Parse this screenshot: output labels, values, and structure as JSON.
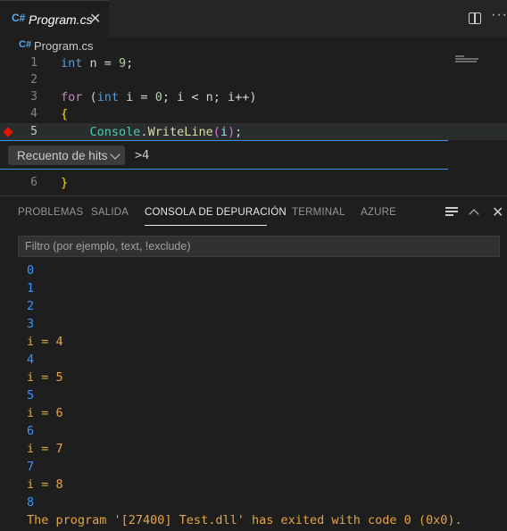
{
  "tab": {
    "icon": "C#",
    "label": "Program.cs",
    "close": "✕"
  },
  "actions": {
    "split": "split-editor-icon",
    "more": "···"
  },
  "breadcrumb": {
    "icon": "C#",
    "label": "Program.cs"
  },
  "editor": {
    "lines": [
      {
        "n": "1",
        "tokens": [
          [
            "int",
            "kw"
          ],
          [
            " n = ",
            "plain"
          ],
          [
            "9",
            "num"
          ],
          [
            ";",
            "plain"
          ]
        ]
      },
      {
        "n": "2",
        "tokens": []
      },
      {
        "n": "3",
        "tokens": [
          [
            "for",
            "kw2"
          ],
          [
            " (",
            "plain"
          ],
          [
            "int",
            "kw"
          ],
          [
            " i = ",
            "plain"
          ],
          [
            "0",
            "num"
          ],
          [
            "; i < n; i++)",
            "plain"
          ]
        ]
      },
      {
        "n": "4",
        "tokens": [
          [
            "{",
            "brace"
          ]
        ]
      },
      {
        "n": "5",
        "tokens": [
          [
            "    ",
            "plain"
          ],
          [
            "Console",
            "cls"
          ],
          [
            ".",
            "plain"
          ],
          [
            "WriteLine",
            "fn"
          ],
          [
            "(",
            "paren"
          ],
          [
            "i",
            "var"
          ],
          [
            ")",
            "paren"
          ],
          [
            ";",
            "plain"
          ]
        ]
      },
      {
        "n": "6",
        "tokens": [
          [
            "}",
            "brace"
          ]
        ]
      }
    ]
  },
  "breakpoint_widget": {
    "condition_type": "Recuento de hits",
    "value": ">4"
  },
  "panel": {
    "tabs": [
      "PROBLEMAS",
      "SALIDA",
      "CONSOLA DE DEPURACIÓN",
      "TERMINAL",
      "AZURE"
    ],
    "active_tab": "CONSOLA DE DEPURACIÓN",
    "filter_placeholder": "Filtro (por ejemplo, text, !exclude)",
    "output": [
      {
        "text": "0",
        "color": "blue"
      },
      {
        "text": "1",
        "color": "blue"
      },
      {
        "text": "2",
        "color": "blue"
      },
      {
        "text": "3",
        "color": "blue"
      },
      {
        "text": "i = 4",
        "color": "orange"
      },
      {
        "text": "4",
        "color": "blue"
      },
      {
        "text": "i = 5",
        "color": "orange"
      },
      {
        "text": "5",
        "color": "blue"
      },
      {
        "text": "i = 6",
        "color": "orange"
      },
      {
        "text": "6",
        "color": "blue"
      },
      {
        "text": "i = 7",
        "color": "orange"
      },
      {
        "text": "7",
        "color": "blue"
      },
      {
        "text": "i = 8",
        "color": "orange"
      },
      {
        "text": "8",
        "color": "blue"
      },
      {
        "text": "The program '[27400] Test.dll' has exited with code 0 (0x0).",
        "color": "orange"
      }
    ]
  },
  "colors": {
    "accent": "#3794ff",
    "breakpoint": "#e51400",
    "output_blue": "#3794ff",
    "output_orange": "#e5a545"
  }
}
